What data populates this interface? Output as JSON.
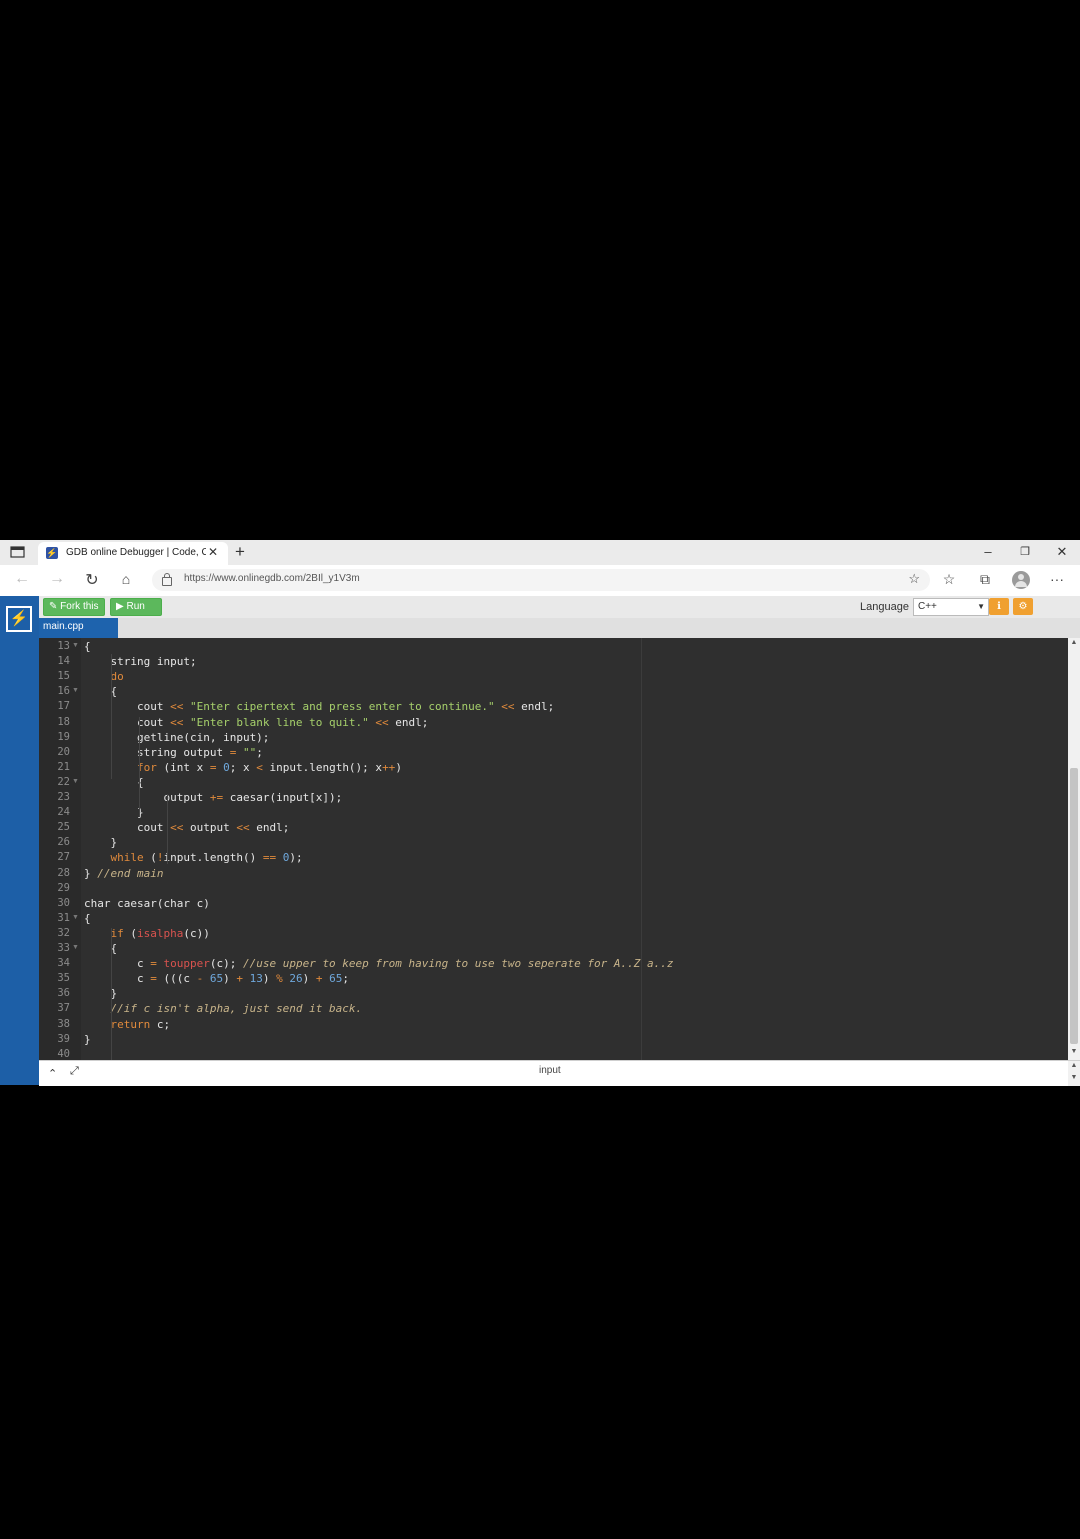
{
  "browser": {
    "tab_title": "GDB online Debugger | Code, Co",
    "url": "https://www.onlinegdb.com/2BIl_y1V3m",
    "icons": [
      "tab-actions-icon",
      "close-icon",
      "plus-icon",
      "minimize-icon",
      "restore-icon",
      "back-icon",
      "forward-icon",
      "refresh-icon",
      "home-icon",
      "lock-icon",
      "add-favorite-icon",
      "favorites-icon",
      "collections-icon",
      "profile-icon",
      "more-icon"
    ]
  },
  "app": {
    "fork_label": "Fork this",
    "run_label": "Run",
    "language_label": "Language",
    "language_value": "C++",
    "file_tab": "main.cpp",
    "bottom_label": "input"
  },
  "editor": {
    "lines": [
      {
        "n": "13",
        "code": "{",
        "fold": true
      },
      {
        "n": "14",
        "code": "    string input;"
      },
      {
        "n": "15",
        "code": "    do"
      },
      {
        "n": "16",
        "code": "    {",
        "fold": true
      },
      {
        "n": "17",
        "code": "        cout << \"Enter cipertext and press enter to continue.\" << endl;"
      },
      {
        "n": "18",
        "code": "        cout << \"Enter blank line to quit.\" << endl;"
      },
      {
        "n": "19",
        "code": "        getline(cin, input);"
      },
      {
        "n": "20",
        "code": "        string output = \"\";"
      },
      {
        "n": "21",
        "code": "        for (int x = 0; x < input.length(); x++)"
      },
      {
        "n": "22",
        "code": "        {",
        "fold": true
      },
      {
        "n": "23",
        "code": "            output += caesar(input[x]);"
      },
      {
        "n": "24",
        "code": "        }"
      },
      {
        "n": "25",
        "code": "        cout << output << endl;"
      },
      {
        "n": "26",
        "code": "    }"
      },
      {
        "n": "27",
        "code": "    while (!input.length() == 0);"
      },
      {
        "n": "28",
        "code": "} //end main"
      },
      {
        "n": "29",
        "code": ""
      },
      {
        "n": "30",
        "code": "char caesar(char c)"
      },
      {
        "n": "31",
        "code": "{",
        "fold": true
      },
      {
        "n": "32",
        "code": "    if (isalpha(c))"
      },
      {
        "n": "33",
        "code": "    {",
        "fold": true
      },
      {
        "n": "34",
        "code": "        c = toupper(c); //use upper to keep from having to use two seperate for A..Z a..z"
      },
      {
        "n": "35",
        "code": "        c = (((c - 65) + 13) % 26) + 65;"
      },
      {
        "n": "36",
        "code": "    }"
      },
      {
        "n": "37",
        "code": "    //if c isn't alpha, just send it back."
      },
      {
        "n": "38",
        "code": "    return c;"
      },
      {
        "n": "39",
        "code": "}"
      },
      {
        "n": "40",
        "code": ""
      }
    ]
  },
  "colors": {
    "sidebar": "#1d5fa7",
    "run_green": "#5cb85c",
    "editor_bg": "#2f2f2f",
    "keyword": "#e08a3c",
    "string": "#a6d06b",
    "comment": "#c8b48a",
    "number": "#6fa8dc",
    "builtin": "#d9534f"
  }
}
